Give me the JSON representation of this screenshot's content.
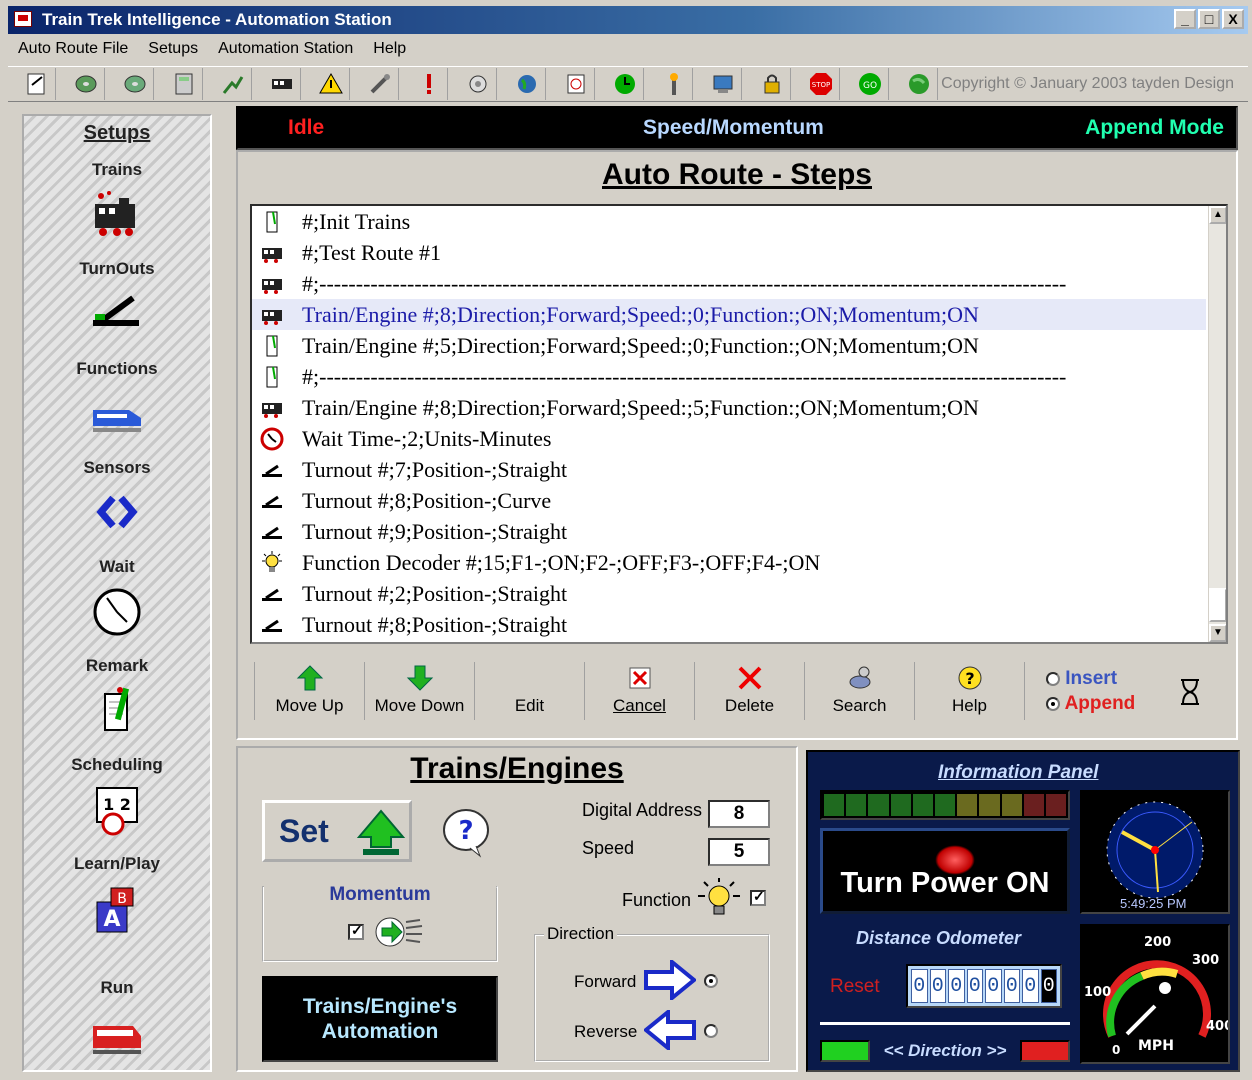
{
  "window": {
    "title": "Train Trek Intelligence - Automation Station",
    "controls": [
      "_",
      "□",
      "X"
    ]
  },
  "menu": [
    "Auto Route File",
    "Setups",
    "Automation Station",
    "Help"
  ],
  "toolbar": {
    "icons": [
      "notepad-icon",
      "disk-icon",
      "disk-icon",
      "calculator-icon",
      "chart-icon",
      "train-icon",
      "warning-icon",
      "tools-icon",
      "exclamation-icon",
      "settings-icon",
      "world-icon",
      "clock-icon",
      "green-clock-icon",
      "signal-icon",
      "computer-icon",
      "lock-icon",
      "stop-icon",
      "go-icon",
      "globe-icon"
    ],
    "copyright": "Copyright © January 2003 tayden Design"
  },
  "sidebar": {
    "header": "Setups",
    "items": [
      {
        "label": "Trains",
        "icon": "train-icon"
      },
      {
        "label": "TurnOuts",
        "icon": "turnout-icon"
      },
      {
        "label": "Functions",
        "icon": "functions-icon"
      },
      {
        "label": "Sensors",
        "icon": "sensor-icon"
      },
      {
        "label": "Wait",
        "icon": "clock-icon"
      },
      {
        "label": "Remark",
        "icon": "remark-icon"
      },
      {
        "label": "Scheduling",
        "icon": "calendar-icon"
      },
      {
        "label": "Learn/Play",
        "icon": "blocks-icon"
      },
      {
        "label": "Run",
        "icon": "run-train-icon"
      }
    ]
  },
  "status": {
    "state": "Idle",
    "mode_label": "Speed/Momentum",
    "insert_mode": "Append Mode"
  },
  "steps": {
    "title": "Auto Route - Steps",
    "rows": [
      {
        "icon": "remark-icon",
        "text": "#;Init Trains"
      },
      {
        "icon": "train-icon",
        "text": "#;Test Route #1"
      },
      {
        "icon": "train-icon",
        "text": "#;------------------------------------------------------------------------------------------------------"
      },
      {
        "icon": "train-icon",
        "text": "Train/Engine #;8;Direction;Forward;Speed:;0;Function:;ON;Momentum;ON",
        "selected": true
      },
      {
        "icon": "remark-icon",
        "text": "Train/Engine #;5;Direction;Forward;Speed:;0;Function:;ON;Momentum;ON"
      },
      {
        "icon": "remark-icon",
        "text": "#;------------------------------------------------------------------------------------------------------"
      },
      {
        "icon": "train-icon",
        "text": "Train/Engine #;8;Direction;Forward;Speed:;5;Function:;ON;Momentum;ON"
      },
      {
        "icon": "wait-icon",
        "text": "Wait Time-;2;Units-Minutes"
      },
      {
        "icon": "turnout-icon",
        "text": "Turnout #;7;Position-;Straight"
      },
      {
        "icon": "turnout-icon",
        "text": "Turnout #;8;Position-;Curve"
      },
      {
        "icon": "turnout-icon",
        "text": "Turnout #;9;Position-;Straight"
      },
      {
        "icon": "bulb-icon",
        "text": "Function Decoder #;15;F1-;ON;F2-;OFF;F3-;OFF;F4-;ON"
      },
      {
        "icon": "turnout-icon",
        "text": "Turnout #;2;Position-;Straight"
      },
      {
        "icon": "turnout-icon",
        "text": "Turnout #;8;Position-;Straight"
      }
    ],
    "actions": {
      "move_up": "Move Up",
      "move_down": "Move Down",
      "edit": "Edit",
      "cancel": "Cancel",
      "delete": "Delete",
      "search": "Search",
      "help": "Help"
    },
    "mode_options": {
      "insert": "Insert",
      "append": "Append",
      "selected": "Append"
    }
  },
  "trains": {
    "title": "Trains/Engines",
    "set_label": "Set",
    "momentum_label": "Momentum",
    "momentum_checked": true,
    "automation_line1": "Trains/Engine's",
    "automation_line2": "Automation",
    "address_label": "Digital Address",
    "address_value": "8",
    "speed_label": "Speed",
    "speed_value": "5",
    "function_label": "Function",
    "function_checked": true,
    "direction_label": "Direction",
    "forward_label": "Forward",
    "reverse_label": "Reverse",
    "direction_selected": "Forward"
  },
  "info": {
    "title": "Information Panel",
    "power_label": "Turn Power ON",
    "clock_time": "5:49:25 PM",
    "odometer_title": "Distance Odometer",
    "reset_label": "Reset",
    "odometer_digits": [
      "0",
      "0",
      "0",
      "0",
      "0",
      "0",
      "0",
      "0"
    ],
    "direction_label": "<< Direction >>",
    "speedo": {
      "ticks": [
        "0",
        "100",
        "200",
        "300",
        "400"
      ],
      "unit": "MPH"
    },
    "led_colors": [
      "#1f6a1f",
      "#1f6a1f",
      "#1f6a1f",
      "#1f6a1f",
      "#1f6a1f",
      "#1f6a1f",
      "#6a6a1f",
      "#6a6a1f",
      "#6a6a1f",
      "#6a1f1f",
      "#6a1f1f"
    ]
  }
}
